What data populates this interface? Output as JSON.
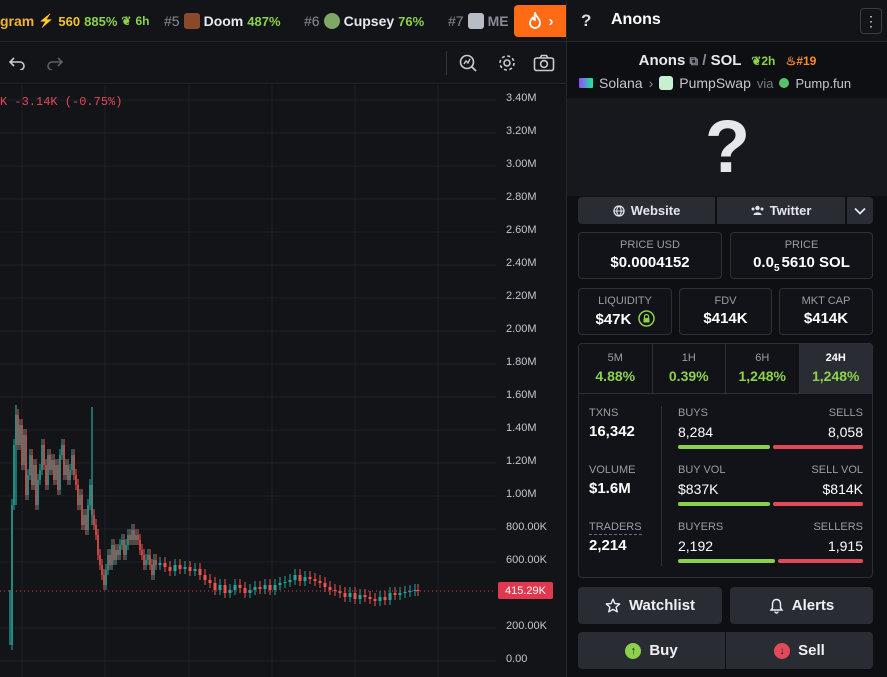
{
  "ticker": [
    {
      "name": "gram",
      "boost": "560",
      "pct": "885%",
      "age": "6h"
    },
    {
      "rank": "#5",
      "name": "Doom",
      "pct": "487%"
    },
    {
      "rank": "#6",
      "name": "Cupsey",
      "pct": "76%"
    },
    {
      "rank": "#7",
      "name": "ME"
    }
  ],
  "chart": {
    "change_label": "K -3.14K (-0.75%)",
    "y_labels": [
      "3.40M",
      "3.20M",
      "3.00M",
      "2.80M",
      "2.60M",
      "2.40M",
      "2.20M",
      "2.00M",
      "1.80M",
      "1.60M",
      "1.40M",
      "1.20M",
      "1.00M",
      "800.00K",
      "600.00K",
      "200.00K",
      "0.00"
    ],
    "current_price_tag": "415.29K"
  },
  "colors": {
    "up": "#26a69a",
    "down": "#ef5350",
    "accent": "#ff6a14",
    "positive": "#8bd14c",
    "negative": "#e24a5a"
  },
  "panel": {
    "help_glyph": "?",
    "token_name": "Anons",
    "pair": {
      "base": "Anons",
      "quote": "SOL",
      "age": "2h",
      "rank": "#19"
    },
    "chain": {
      "network": "Solana",
      "dex": "PumpSwap",
      "via_label": "via",
      "launchpad": "Pump.fun"
    },
    "hero_glyph": "?",
    "links": {
      "website": "Website",
      "twitter": "Twitter"
    },
    "price_usd": {
      "label": "PRICE USD",
      "value": "$0.0004152"
    },
    "price_sol": {
      "label": "PRICE",
      "prefix": "0.0",
      "zeros": "5",
      "suffix": "5610 SOL"
    },
    "liquidity": {
      "label": "LIQUIDITY",
      "value": "$47K"
    },
    "fdv": {
      "label": "FDV",
      "value": "$414K"
    },
    "mkt_cap": {
      "label": "MKT CAP",
      "value": "$414K"
    },
    "timeframes": [
      {
        "label": "5M",
        "pct": "4.88%"
      },
      {
        "label": "1H",
        "pct": "0.39%"
      },
      {
        "label": "6H",
        "pct": "1,248%"
      },
      {
        "label": "24H",
        "pct": "1,248%"
      }
    ],
    "stats": {
      "txns": {
        "label": "TXNS",
        "value": "16,342"
      },
      "volume": {
        "label": "VOLUME",
        "value": "$1.6M"
      },
      "traders": {
        "label": "TRADERS",
        "value": "2,214"
      },
      "buys": {
        "label": "BUYS",
        "value": "8,284"
      },
      "sells": {
        "label": "SELLS",
        "value": "8,058"
      },
      "buy_vol": {
        "label": "BUY VOL",
        "value": "$837K"
      },
      "sell_vol": {
        "label": "SELL VOL",
        "value": "$814K"
      },
      "buyers": {
        "label": "BUYERS",
        "value": "2,192"
      },
      "sellers": {
        "label": "SELLERS",
        "value": "1,915"
      }
    },
    "actions": {
      "watchlist": "Watchlist",
      "alerts": "Alerts",
      "buy": "Buy",
      "sell": "Sell"
    }
  }
}
